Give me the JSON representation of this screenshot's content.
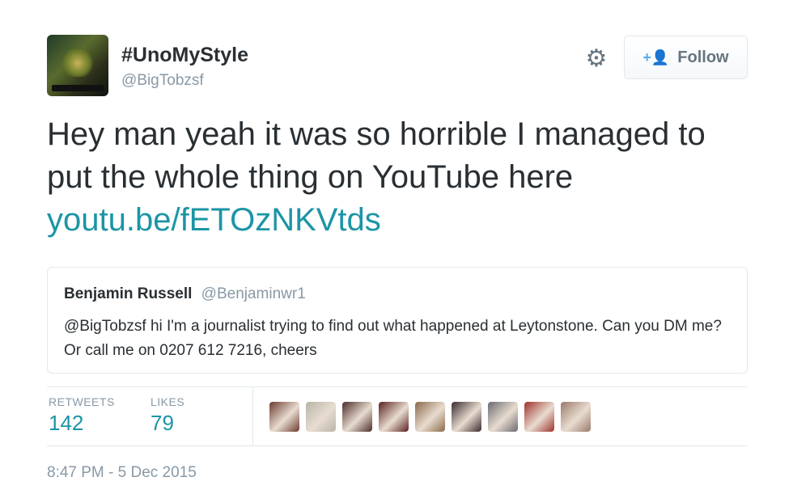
{
  "author": {
    "display_name": "#UnoMyStyle",
    "handle": "@BigTobzsf",
    "avatar_icon": "profile-avatar"
  },
  "actions": {
    "settings_icon": "gear-icon",
    "follow_label": "Follow",
    "follow_icon": "add-user-icon"
  },
  "tweet": {
    "text": "Hey man yeah it was so horrible I managed to put the whole thing on YouTube here",
    "link": "youtu.be/fETOzNKVtds"
  },
  "quoted_tweet": {
    "author_name": "Benjamin Russell",
    "author_handle": "@Benjaminwr1",
    "text": "@BigTobzsf hi I'm a journalist trying to find out what happened at Leytonstone. Can you DM me? Or call me on 0207 612 7216, cheers"
  },
  "stats": {
    "retweets_label": "RETWEETS",
    "retweets_count": "142",
    "likes_label": "LIKES",
    "likes_count": "79"
  },
  "liked_by": [
    {
      "color": "#6b3a2e"
    },
    {
      "color": "#b8b4a8"
    },
    {
      "color": "#4a2b28"
    },
    {
      "color": "#5a2020"
    },
    {
      "color": "#8a6a4a"
    },
    {
      "color": "#3a2a2e"
    },
    {
      "color": "#6a6a70"
    },
    {
      "color": "#a0302a"
    },
    {
      "color": "#9a7a6a"
    }
  ],
  "timestamp": "8:47 PM - 5 Dec 2015",
  "colors": {
    "link": "#1b95a5",
    "muted": "#8899a6",
    "text": "#292f33",
    "border": "#e1e8ed"
  }
}
